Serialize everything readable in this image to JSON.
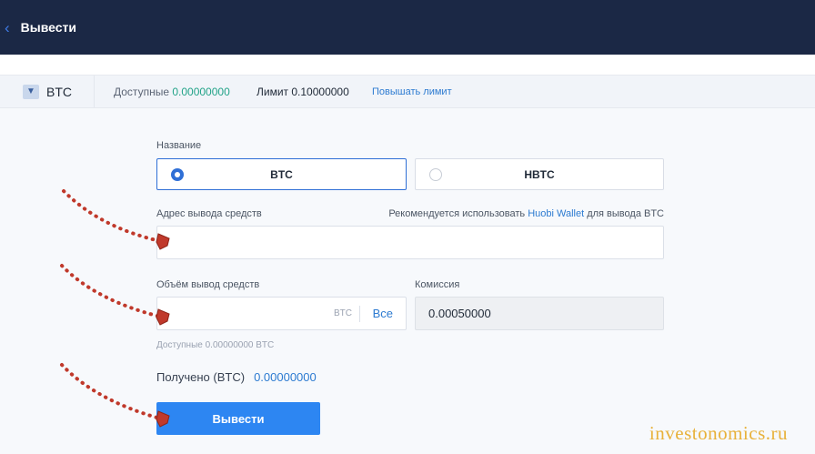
{
  "header": {
    "title": "Вывести",
    "back_icon": "chevron-left-icon"
  },
  "coin_bar": {
    "coin": "BTC",
    "available_label": "Доступные",
    "available_value": "0.00000000",
    "limit_label": "Лимит",
    "limit_value": "0.10000000",
    "raise_limit": "Повышать лимит"
  },
  "form": {
    "chain_label": "Название",
    "chains": [
      {
        "label": "BTC",
        "selected": true
      },
      {
        "label": "HBTC",
        "selected": false
      }
    ],
    "address_label": "Адрес вывода средств",
    "address_hint_prefix": "Рекомендуется использовать",
    "address_hint_link": "Huobi Wallet",
    "address_hint_suffix": "для вывода BTC",
    "address_value": "",
    "amount_label": "Объём вывод средств",
    "amount_value": "",
    "amount_unit": "BTC",
    "all_label": "Все",
    "fee_label": "Комиссия",
    "fee_value": "0.00050000",
    "available_note": "Доступные 0.00000000 BTC",
    "received_label": "Получено (BTC)",
    "received_value": "0.00000000",
    "submit_label": "Вывести"
  },
  "watermark": "investonomics.ru",
  "colors": {
    "header_bg": "#1b2845",
    "accent": "#2d86f2",
    "available_green": "#22a388",
    "arrow_red": "#c0392b",
    "watermark": "#e8b13a"
  }
}
